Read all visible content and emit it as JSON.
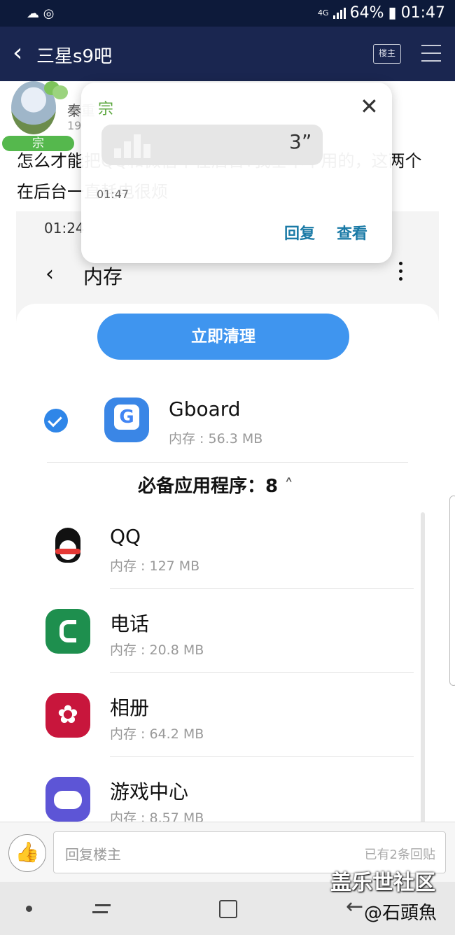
{
  "status_bar": {
    "network": "4G",
    "battery": "64%",
    "time": "01:47"
  },
  "navbar": {
    "title": "三星s9吧",
    "owner_button": "楼主"
  },
  "post": {
    "username": "秦重",
    "avatar_badge": "宗",
    "date": "19",
    "text": "怎么才能把QQ和微信不在后台?我基本不用的，这两个在后台一直耗电很烦"
  },
  "embedded_screenshot": {
    "time": "01:24",
    "title": "内存",
    "clean_button": "立即清理",
    "selected_app": {
      "name": "Gboard",
      "memory": "内存 : 56.3 MB"
    },
    "section_header": "必备应用程序：8",
    "apps": [
      {
        "name": "QQ",
        "memory": "内存 : 127 MB",
        "color": "#ffffff"
      },
      {
        "name": "电话",
        "memory": "内存 : 20.8 MB",
        "color": "#1e8f4e"
      },
      {
        "name": "相册",
        "memory": "内存 : 64.2 MB",
        "color": "#c8163c"
      },
      {
        "name": "游戏中心",
        "memory": "内存 : 8.57 MB",
        "color": "#5d55d6"
      }
    ]
  },
  "popup": {
    "sender": "宗",
    "duration": "3”",
    "time": "01:47",
    "reply_label": "回复",
    "view_label": "查看"
  },
  "reply_bar": {
    "placeholder": "回复楼主",
    "count": "已有2条回贴"
  },
  "watermark": {
    "site": "盖乐世社区",
    "author": "@石頭魚"
  }
}
